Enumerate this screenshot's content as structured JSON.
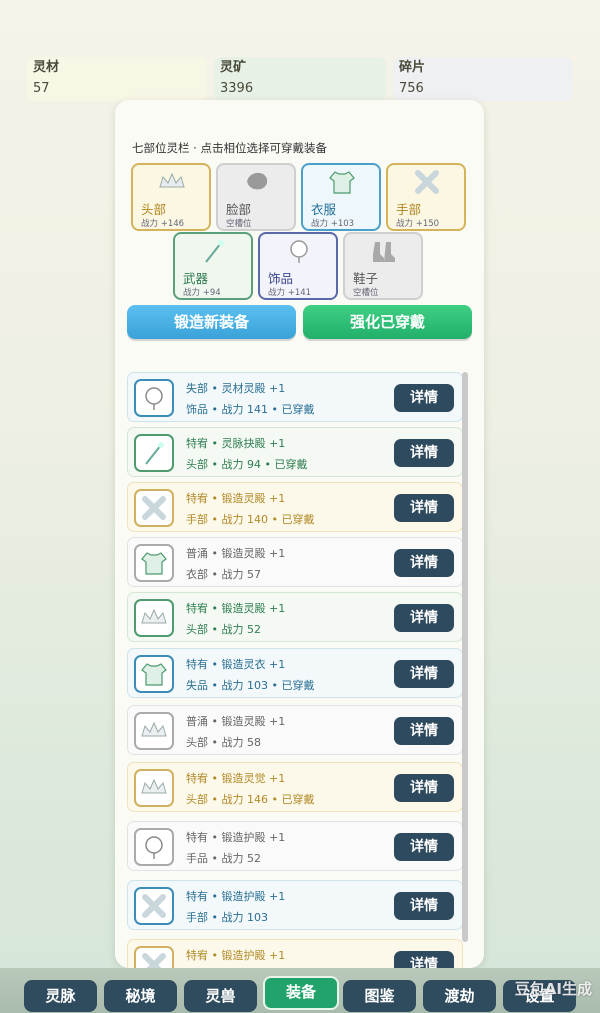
{
  "resources": [
    {
      "label": "灵材",
      "value": "57"
    },
    {
      "label": "灵矿",
      "value": "3396"
    },
    {
      "label": "碎片",
      "value": "756"
    }
  ],
  "panel": {
    "title": "七部位灵栏 · 点击相位选择可穿戴装备",
    "slots": [
      {
        "name": "头部",
        "power": "战力 +146",
        "icon": "crown-icon"
      },
      {
        "name": "脸部",
        "power": "空槽位",
        "icon": "mask-icon"
      },
      {
        "name": "衣服",
        "power": "战力 +103",
        "icon": "armor-icon"
      },
      {
        "name": "手部",
        "power": "战力 +150",
        "icon": "gauntlet-icon"
      },
      {
        "name": "武器",
        "power": "战力 +94",
        "icon": "staff-icon"
      },
      {
        "name": "饰品",
        "power": "战力 +141",
        "icon": "amulet-icon"
      },
      {
        "name": "鞋子",
        "power": "空槽位",
        "icon": "boots-icon"
      }
    ],
    "forge_label": "锻造新装备",
    "enhance_label": "强化已穿戴"
  },
  "equipment": [
    {
      "line1": "失部 • 灵材灵殿 +1",
      "line2": "饰品 • 战力 141 • 已穿戴",
      "icon": "amulet-icon",
      "color": "blue"
    },
    {
      "line1": "特宥 • 灵脉抉殿 +1",
      "line2": "头部 • 战力 94 • 已穿戴",
      "icon": "staff-icon",
      "color": "green"
    },
    {
      "line1": "特宥 • 锻造灵殿 +1",
      "line2": "手部 • 战力 140 • 已穿戴",
      "icon": "gauntlet-icon",
      "color": "gold"
    },
    {
      "line1": "普涌 • 锻造灵殿 +1",
      "line2": "衣部 • 战力 57",
      "icon": "armor-icon",
      "color": "gray"
    },
    {
      "line1": "特宥 • 锻造灵殿 +1",
      "line2": "头部 • 战力 52",
      "icon": "crown-icon",
      "color": "green"
    },
    {
      "line1": "特有 • 锻造灵衣 +1",
      "line2": "失品 • 战力 103 • 已穿戴",
      "icon": "armor-icon",
      "color": "blue"
    },
    {
      "line1": "普涌 • 锻造灵殿 +1",
      "line2": "头部 • 战力 58",
      "icon": "crown-icon",
      "color": "gray"
    },
    {
      "line1": "特宥 • 锻造灵觉 +1",
      "line2": "头部 • 战力 146 • 已穿戴",
      "icon": "crown-icon",
      "color": "gold"
    },
    {
      "line1": "特有 • 锻造护殿 +1",
      "line2": "手品 • 战力 52",
      "icon": "amulet-icon",
      "color": "gray"
    },
    {
      "line1": "特有 • 锻造护殿 +1",
      "line2": "手部 • 战力 103",
      "icon": "gauntlet-icon",
      "color": "blue"
    },
    {
      "line1": "特宥 • 锻造护殿 +1",
      "line2": "",
      "icon": "gauntlet-icon",
      "color": "gold"
    }
  ],
  "detail_label": "详情",
  "nav": [
    {
      "label": "灵脉"
    },
    {
      "label": "秘境"
    },
    {
      "label": "灵兽"
    },
    {
      "label": "装备",
      "active": true
    },
    {
      "label": "图鉴"
    },
    {
      "label": "渡劫"
    },
    {
      "label": "设置"
    }
  ],
  "watermark": "豆包AI生成"
}
